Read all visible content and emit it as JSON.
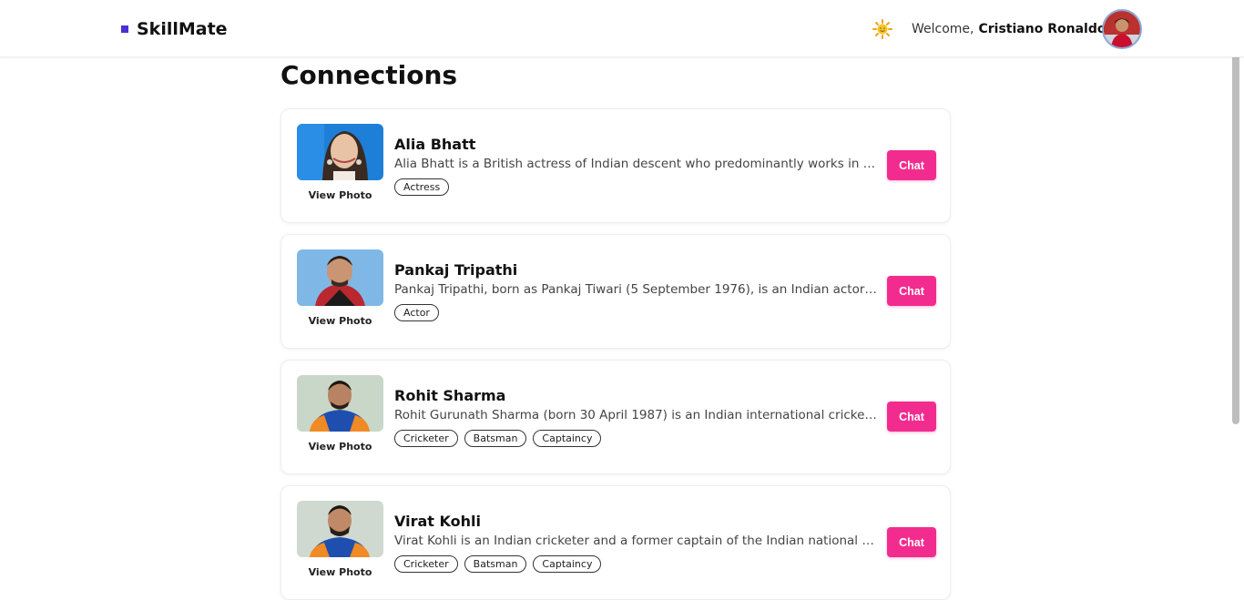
{
  "brand": {
    "name": "SkillMate",
    "accent_color": "#4a2fd4"
  },
  "header": {
    "theme_icon": "sun-icon",
    "welcome_prefix": "Welcome,",
    "user_name": "Cristiano Ronaldo",
    "verified_icon": "verified-badge-icon",
    "avatar_icon": "user-avatar"
  },
  "page": {
    "title": "Connections"
  },
  "connections": [
    {
      "name": "Alia Bhatt",
      "bio": "Alia Bhatt is a British actress of Indian descent who predominantly works in Hindi films.",
      "view_photo": "View Photo",
      "tags": [
        "Actress"
      ],
      "chat_label": "Chat"
    },
    {
      "name": "Pankaj Tripathi",
      "bio": "Pankaj Tripathi, born as Pankaj Tiwari (5 September 1976), is an Indian actor who primarily works in Hindi films.",
      "view_photo": "View Photo",
      "tags": [
        "Actor"
      ],
      "chat_label": "Chat"
    },
    {
      "name": "Rohit Sharma",
      "bio": "Rohit Gurunath Sharma (born 30 April 1987) is an Indian international cricketer and captain.",
      "view_photo": "View Photo",
      "tags": [
        "Cricketer",
        "Batsman",
        "Captaincy"
      ],
      "chat_label": "Chat"
    },
    {
      "name": "Virat Kohli",
      "bio": "Virat Kohli is an Indian cricketer and a former captain of the Indian national cricket team.",
      "view_photo": "View Photo",
      "tags": [
        "Cricketer",
        "Batsman",
        "Captaincy"
      ],
      "chat_label": "Chat"
    }
  ],
  "colors": {
    "chat_button": "#f22c8f",
    "verified": "#2f8de4"
  }
}
